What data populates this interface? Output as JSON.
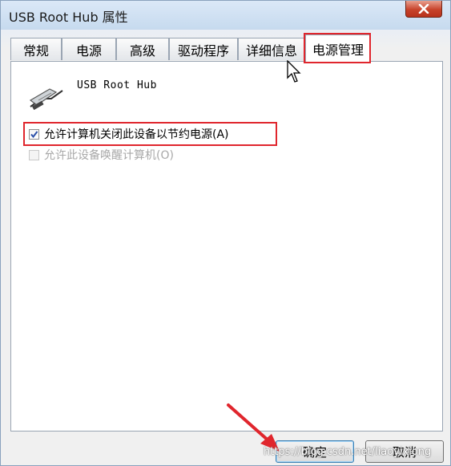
{
  "window": {
    "title": "USB Root Hub 属性",
    "close_symbol": "x"
  },
  "tabs": [
    {
      "label": "常规"
    },
    {
      "label": "电源"
    },
    {
      "label": "高级"
    },
    {
      "label": "驱动程序"
    },
    {
      "label": "详细信息"
    },
    {
      "label": "电源管理",
      "active": true
    }
  ],
  "device": {
    "name": "USB Root Hub",
    "icon": "usb-connector-icon"
  },
  "options": [
    {
      "label": "允许计算机关闭此设备以节约电源(A)",
      "checked": true,
      "enabled": true
    },
    {
      "label": "允许此设备唤醒计算机(O)",
      "checked": false,
      "enabled": false
    }
  ],
  "buttons": {
    "ok": "确定",
    "cancel": "取消"
  },
  "watermark": "https://blog.csdn.net/liaoyixiong",
  "annotation_color": "#e0262d"
}
